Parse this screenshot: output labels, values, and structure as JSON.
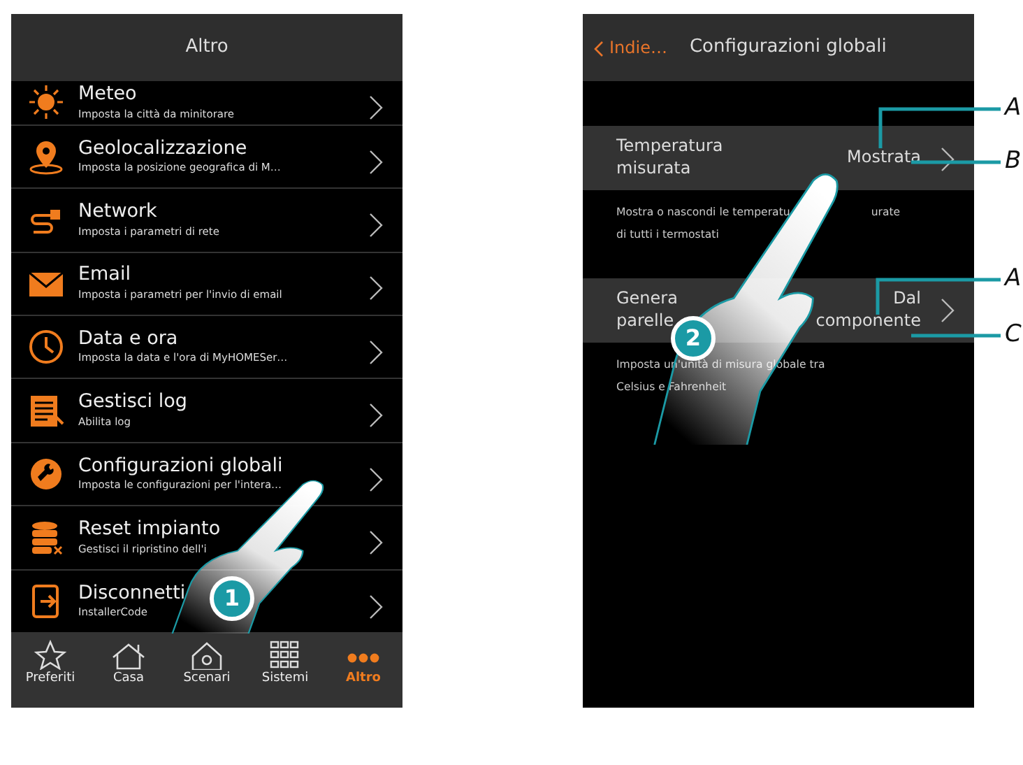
{
  "left_screen": {
    "title": "Altro",
    "menu_items": [
      {
        "kind": "sun",
        "title": "Meteo",
        "subtitle": "Imposta la città da minitorare"
      },
      {
        "kind": "pin",
        "title": "Geolocalizzazione",
        "subtitle": "Imposta la posizione geografica di M…"
      },
      {
        "kind": "plug",
        "title": "Network",
        "subtitle": "Imposta i parametri di rete"
      },
      {
        "kind": "mail",
        "title": "Email",
        "subtitle": "Imposta i parametri per l'invio di email"
      },
      {
        "kind": "clock",
        "title": "Data e ora",
        "subtitle": "Imposta la data e l'ora di MyHOMESer…"
      },
      {
        "kind": "log",
        "title": "Gestisci log",
        "subtitle": "Abilita log"
      },
      {
        "kind": "wrench",
        "title": "Configurazioni globali",
        "subtitle": "Imposta le configurazioni per l'intera…"
      },
      {
        "kind": "db",
        "title": "Reset impianto",
        "subtitle": "Gestisci il ripristino dell'i"
      },
      {
        "kind": "exit",
        "title": "Disconnetti",
        "subtitle": "InstallerCode"
      }
    ],
    "tab_bar": [
      {
        "kind": "star",
        "label": "Preferiti",
        "selected": false
      },
      {
        "kind": "house",
        "label": "Casa",
        "selected": false
      },
      {
        "kind": "scene",
        "label": "Scenari",
        "selected": false
      },
      {
        "kind": "grid",
        "label": "Sistemi",
        "selected": false
      },
      {
        "kind": "dots",
        "label": "Altro",
        "selected": true
      }
    ]
  },
  "right_screen": {
    "back_button": "Indie…",
    "title": "Configurazioni globali",
    "settings": [
      {
        "label": [
          "Temperatura misurata"
        ],
        "value": "Mostrata",
        "description": [
          [
            "Mostra o nascondi le temperatu",
            "urate"
          ],
          [
            "di tutti i termostati"
          ]
        ]
      },
      {
        "label": [
          "Genera",
          "parelle"
        ],
        "value": "Dal componente",
        "description": [
          [
            "Imposta un'unità di misura globale tra"
          ],
          [
            "Celsius e Fahrenheit"
          ]
        ]
      }
    ]
  },
  "step_markers": [
    "1",
    "2"
  ],
  "callouts": [
    {
      "letter": "A"
    },
    {
      "letter": "B"
    },
    {
      "letter": "A"
    },
    {
      "letter": "C"
    }
  ]
}
